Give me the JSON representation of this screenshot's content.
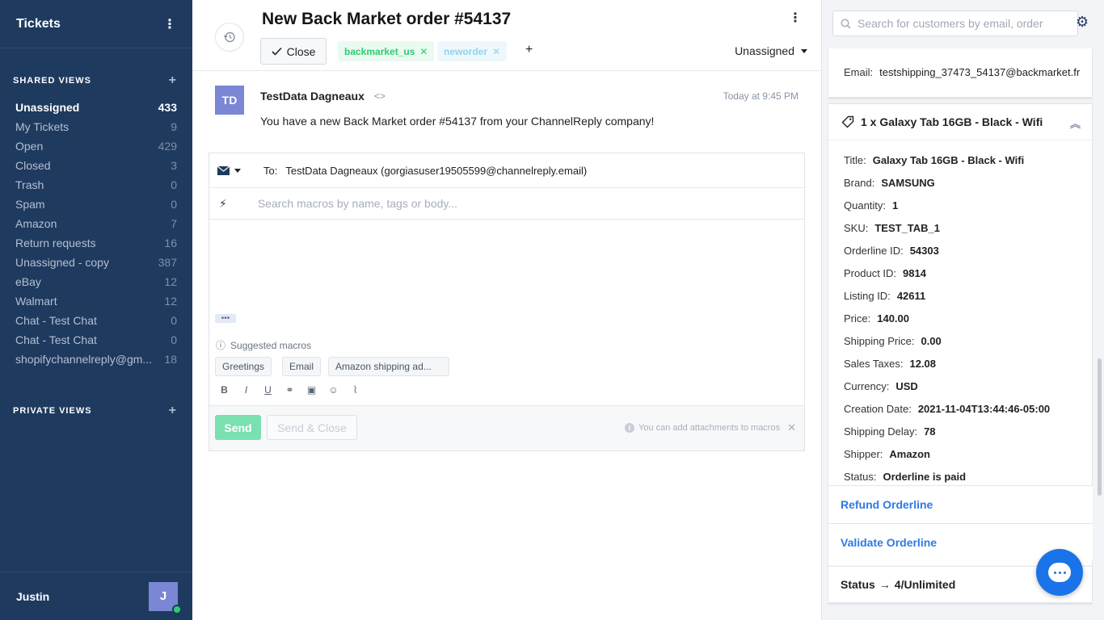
{
  "sidebar": {
    "title": "Tickets",
    "shared_views_label": "SHARED VIEWS",
    "private_views_label": "PRIVATE VIEWS",
    "views": [
      {
        "name": "Unassigned",
        "count": "433",
        "active": true
      },
      {
        "name": "My Tickets",
        "count": "9"
      },
      {
        "name": "Open",
        "count": "429"
      },
      {
        "name": "Closed",
        "count": "3"
      },
      {
        "name": "Trash",
        "count": "0"
      },
      {
        "name": "Spam",
        "count": "0"
      },
      {
        "name": "Amazon",
        "count": "7"
      },
      {
        "name": "Return requests",
        "count": "16"
      },
      {
        "name": "Unassigned - copy",
        "count": "387"
      },
      {
        "name": "eBay",
        "count": "12"
      },
      {
        "name": "Walmart",
        "count": "12"
      },
      {
        "name": "Chat - Test Chat",
        "count": "0"
      },
      {
        "name": "Chat - Test Chat",
        "count": "0"
      },
      {
        "name": "shopifychannelreply@gm...",
        "count": "18"
      }
    ],
    "user": {
      "name": "Justin",
      "initial": "J"
    }
  },
  "ticket": {
    "title": "New Back Market order #54137",
    "close_label": "Close",
    "tags": [
      "backmarket_us",
      "neworder"
    ],
    "add_tag": "+",
    "assignee": "Unassigned"
  },
  "message": {
    "initials": "TD",
    "sender": "TestData Dagneaux",
    "time": "Today at 9:45 PM",
    "body": "You have a new Back Market order #54137 from your ChannelReply company!"
  },
  "composer": {
    "to_label": "To:",
    "to_value": "TestData Dagneaux (gorgiasuser19505599@channelreply.email)",
    "macro_placeholder": "Search macros by name, tags or body...",
    "ellipsis": "•••",
    "suggested_label": "Suggested macros",
    "suggested_macros": [
      "Greetings",
      "Email",
      "Amazon shipping ad..."
    ],
    "send_label": "Send",
    "send_close_label": "Send & Close",
    "attach_note": "You can add attachments to macros"
  },
  "right_panel": {
    "search_placeholder": "Search for customers by email, order",
    "email_label": "Email:",
    "email_value": "testshipping_37473_54137@backmarket.fr",
    "product_title": "1 x Galaxy Tab 16GB - Black - Wifi",
    "fields": [
      {
        "k": "Title:",
        "v": "Galaxy Tab 16GB - Black - Wifi"
      },
      {
        "k": "Brand:",
        "v": "SAMSUNG"
      },
      {
        "k": "Quantity:",
        "v": "1"
      },
      {
        "k": "SKU:",
        "v": "TEST_TAB_1"
      },
      {
        "k": "Orderline ID:",
        "v": "54303"
      },
      {
        "k": "Product ID:",
        "v": "9814"
      },
      {
        "k": "Listing ID:",
        "v": "42611"
      },
      {
        "k": "Price:",
        "v": "140.00"
      },
      {
        "k": "Shipping Price:",
        "v": "0.00"
      },
      {
        "k": "Sales Taxes:",
        "v": "12.08"
      },
      {
        "k": "Currency:",
        "v": "USD"
      },
      {
        "k": "Creation Date:",
        "v": "2021-11-04T13:44:46-05:00"
      },
      {
        "k": "Shipping Delay:",
        "v": "78"
      },
      {
        "k": "Shipper:",
        "v": "Amazon"
      },
      {
        "k": "Status:",
        "v": "Orderline is paid"
      }
    ],
    "refund_label": "Refund Orderline",
    "validate_label": "Validate Orderline",
    "status_label": "Status",
    "status_arrow": "→",
    "status_value": "4/Unlimited"
  },
  "colors": {
    "sidebar_bg": "#1e3a5f",
    "accent_blue": "#2c7be5",
    "send_green": "#7ae0b0",
    "tag_green": "#2ecc71"
  }
}
